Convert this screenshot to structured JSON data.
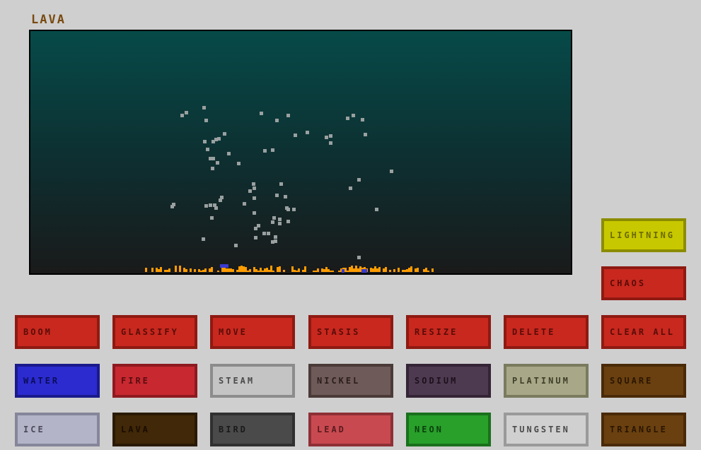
{
  "header": {
    "title": "LAVA"
  },
  "side_buttons": [
    {
      "label": "LIGHTNING",
      "bg": "#c8c800",
      "border": "#8c8c00",
      "text": "#6a6a00"
    },
    {
      "label": "CHAOS",
      "bg": "#c8281e",
      "border": "#8e1a12",
      "text": "#5a0c08"
    }
  ],
  "tool_buttons": [
    {
      "label": "BOOM",
      "bg": "#c8281e",
      "border": "#8e1a12",
      "text": "#5a0c08"
    },
    {
      "label": "GLASSIFY",
      "bg": "#c8281e",
      "border": "#8e1a12",
      "text": "#5a0c08"
    },
    {
      "label": "MOVE",
      "bg": "#c8281e",
      "border": "#8e1a12",
      "text": "#5a0c08"
    },
    {
      "label": "STASIS",
      "bg": "#c8281e",
      "border": "#8e1a12",
      "text": "#5a0c08"
    },
    {
      "label": "RESIZE",
      "bg": "#c8281e",
      "border": "#8e1a12",
      "text": "#5a0c08"
    },
    {
      "label": "DELETE",
      "bg": "#c8281e",
      "border": "#8e1a12",
      "text": "#5a0c08"
    },
    {
      "label": "CLEAR ALL",
      "bg": "#c8281e",
      "border": "#8e1a12",
      "text": "#5a0c08"
    }
  ],
  "element_row1": [
    {
      "label": "WATER",
      "bg": "#2b2bd0",
      "border": "#1a1a8c",
      "text": "#0c0c5a"
    },
    {
      "label": "FIRE",
      "bg": "#c82830",
      "border": "#8e1a20",
      "text": "#5a0c10"
    },
    {
      "label": "STEAM",
      "bg": "#c4c4c4",
      "border": "#8c8c8c",
      "text": "#4a4a4a"
    },
    {
      "label": "NICKEL",
      "bg": "#6e5a58",
      "border": "#4a3a38",
      "text": "#2a1e1c"
    },
    {
      "label": "SODIUM",
      "bg": "#4e3a50",
      "border": "#342436",
      "text": "#1c101c"
    },
    {
      "label": "PLATINUM",
      "bg": "#a8a888",
      "border": "#7a7a5e",
      "text": "#3e3e2a"
    },
    {
      "label": "SQUARE",
      "bg": "#6a4010",
      "border": "#4a2a08",
      "text": "#2a1600"
    }
  ],
  "element_row2": [
    {
      "label": "ICE",
      "bg": "#b4b4c8",
      "border": "#86869a",
      "text": "#4a4a5a"
    },
    {
      "label": "LAVA",
      "bg": "#402808",
      "border": "#2a1a04",
      "text": "#1a0c00"
    },
    {
      "label": "BIRD",
      "bg": "#4a4a4a",
      "border": "#303030",
      "text": "#1a1a1a"
    },
    {
      "label": "LEAD",
      "bg": "#c84a50",
      "border": "#8e3036",
      "text": "#5a1a1e"
    },
    {
      "label": "NEON",
      "bg": "#28a02a",
      "border": "#1a701c",
      "text": "#0c400e"
    },
    {
      "label": "TUNGSTEN",
      "bg": "#d0d0d0",
      "border": "#9a9a9a",
      "text": "#4a4a4a"
    },
    {
      "label": "TRIANGLE",
      "bg": "#6a4010",
      "border": "#4a2a08",
      "text": "#2a1600"
    }
  ],
  "canvas": {
    "particle_color": "#9aa0a0",
    "lava_color": "#ff9c00",
    "water_color": "#3a3ad0"
  }
}
